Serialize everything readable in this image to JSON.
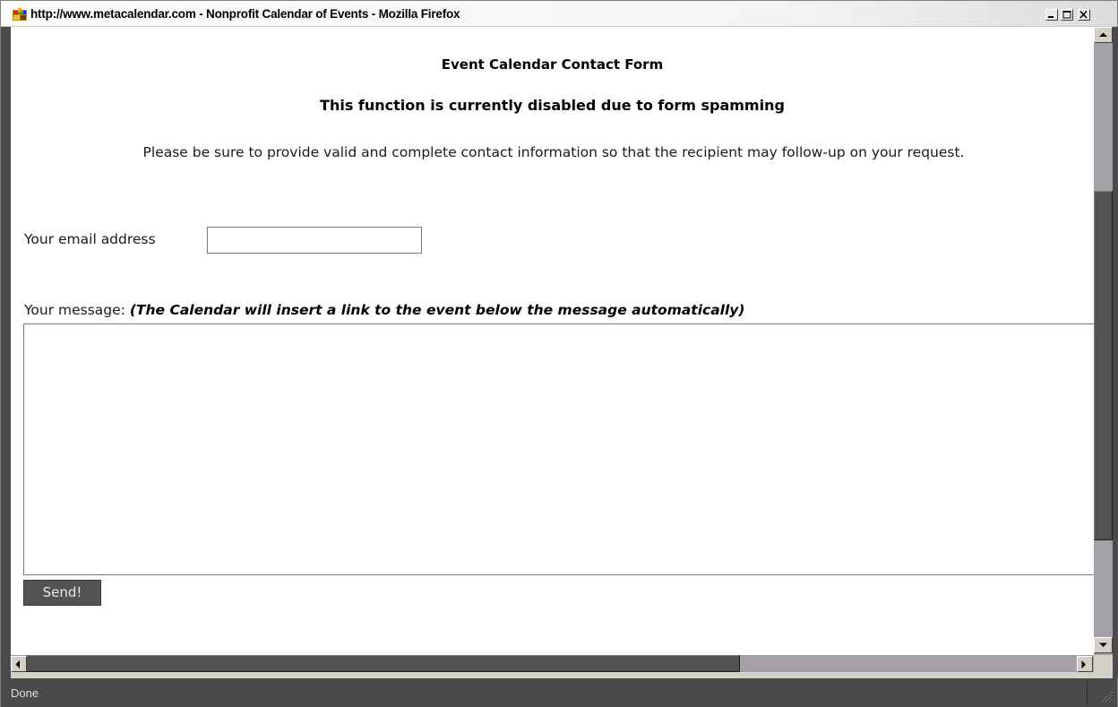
{
  "window": {
    "title": "http://www.metacalendar.com - Nonprofit Calendar of Events - Mozilla Firefox"
  },
  "form": {
    "title": "Event Calendar Contact Form",
    "notice": "This function is currently disabled due to form spamming",
    "intro": "Please be sure to provide valid and complete contact information so that the recipient may follow-up on your request.",
    "email_label": "Your email address",
    "email_value": "",
    "message_label": "Your message:",
    "message_note": "(The Calendar will insert a link to the event below the message automatically)",
    "message_value": "",
    "send_label": "Send!"
  },
  "status": {
    "text": "Done"
  },
  "icons": {
    "app": "firefox-icon",
    "minimize": "minimize-icon",
    "maximize": "maximize-icon",
    "close": "close-icon",
    "scroll_up": "arrow-up-icon",
    "scroll_down": "arrow-down-icon",
    "scroll_left": "arrow-left-icon",
    "scroll_right": "arrow-right-icon",
    "resize_grip": "resize-grip-icon"
  }
}
